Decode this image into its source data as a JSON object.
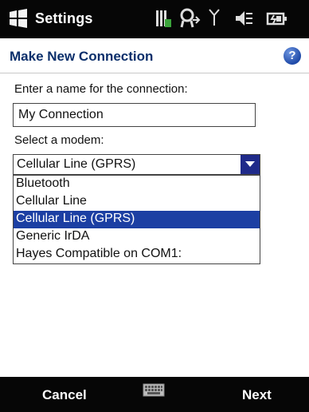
{
  "titlebar": {
    "title": "Settings",
    "icons": [
      "windows-logo-icon",
      "sd-card-icon",
      "connectivity-icon",
      "signal-icon",
      "volume-mute-icon",
      "battery-icon"
    ]
  },
  "subheader": {
    "title": "Make New Connection",
    "help_icon": "help-icon",
    "help_glyph": "?"
  },
  "form": {
    "name_label": "Enter a name for the connection:",
    "name_value": "My Connection",
    "modem_label": "Select a modem:",
    "modem_selected": "Cellular Line (GPRS)",
    "modem_options": [
      "Bluetooth",
      "Cellular Line",
      "Cellular Line (GPRS)",
      "Generic IrDA",
      "Hayes Compatible on COM1:"
    ],
    "selected_index": 2
  },
  "softkeys": {
    "left": "Cancel",
    "right": "Next",
    "center_icon": "keyboard-icon"
  },
  "colors": {
    "bar": "#060606",
    "selection": "#1c3fa3",
    "heading": "#0b2f6b"
  }
}
